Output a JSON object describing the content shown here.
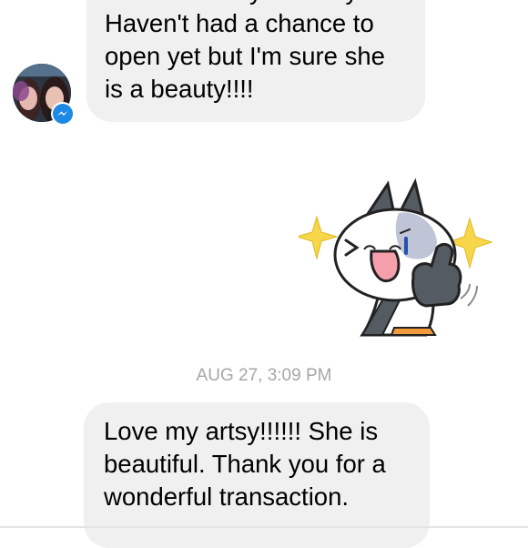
{
  "messages": [
    {
      "lines": [
        "received her yesterday.",
        "Haven't had a chance to",
        "open yet but I'm sure she",
        "is a beauty!!!!"
      ]
    },
    {
      "lines": [
        "Love my artsy!!!!!!  She is",
        "beautiful. Thank you for a",
        "wonderful transaction."
      ]
    }
  ],
  "timestamp": "AUG 27, 3:09 PM",
  "icons": {
    "badge": "messenger-icon",
    "sticker": "cat-thumbs-up-sticker"
  },
  "colors": {
    "bubble": "#f1f0f0",
    "messenger_blue": "#1e88e5",
    "timestamp": "#a7a7a7",
    "sparkle": "#f7d64a"
  }
}
